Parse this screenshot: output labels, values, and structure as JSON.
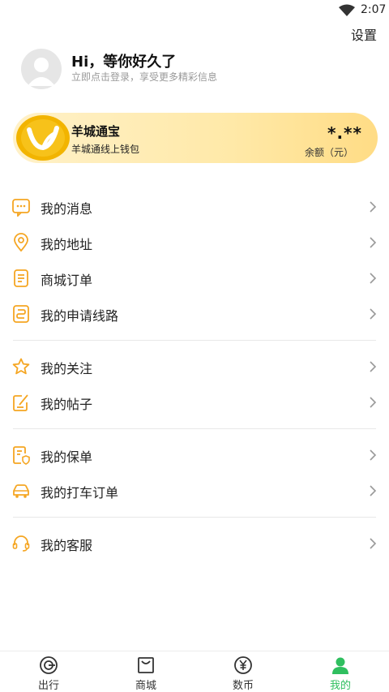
{
  "status_bar": {
    "time": "2:07",
    "wifi_icon": "wifi-icon"
  },
  "header": {
    "settings_label": "设置"
  },
  "profile": {
    "greeting": "Hi，等你好久了",
    "subtitle": "立即点击登录，享受更多精彩信息"
  },
  "wallet_card": {
    "title": "羊城通宝",
    "subtitle": "羊城通线上钱包",
    "amount": "*.**",
    "amount_label": "余额（元）"
  },
  "menu_groups": [
    [
      {
        "label": "我的消息",
        "icon": "message-icon"
      },
      {
        "label": "我的地址",
        "icon": "location-icon"
      },
      {
        "label": "商城订单",
        "icon": "order-list-icon"
      },
      {
        "label": "我的申请线路",
        "icon": "route-icon"
      }
    ],
    [
      {
        "label": "我的关注",
        "icon": "star-icon"
      },
      {
        "label": "我的帖子",
        "icon": "post-icon"
      }
    ],
    [
      {
        "label": "我的保单",
        "icon": "policy-icon"
      },
      {
        "label": "我的打车订单",
        "icon": "taxi-icon"
      }
    ],
    [
      {
        "label": "我的客服",
        "icon": "headset-icon"
      }
    ]
  ],
  "tabs": [
    {
      "label": "出行",
      "icon": "travel-icon",
      "active": false
    },
    {
      "label": "商城",
      "icon": "shop-icon",
      "active": false
    },
    {
      "label": "数币",
      "icon": "yuan-coin-icon",
      "active": false
    },
    {
      "label": "我的",
      "icon": "user-icon",
      "active": true
    }
  ],
  "colors": {
    "accent_orange": "#f5a623",
    "active_green": "#2fbf5f",
    "card_gold": "#ffdc85"
  }
}
